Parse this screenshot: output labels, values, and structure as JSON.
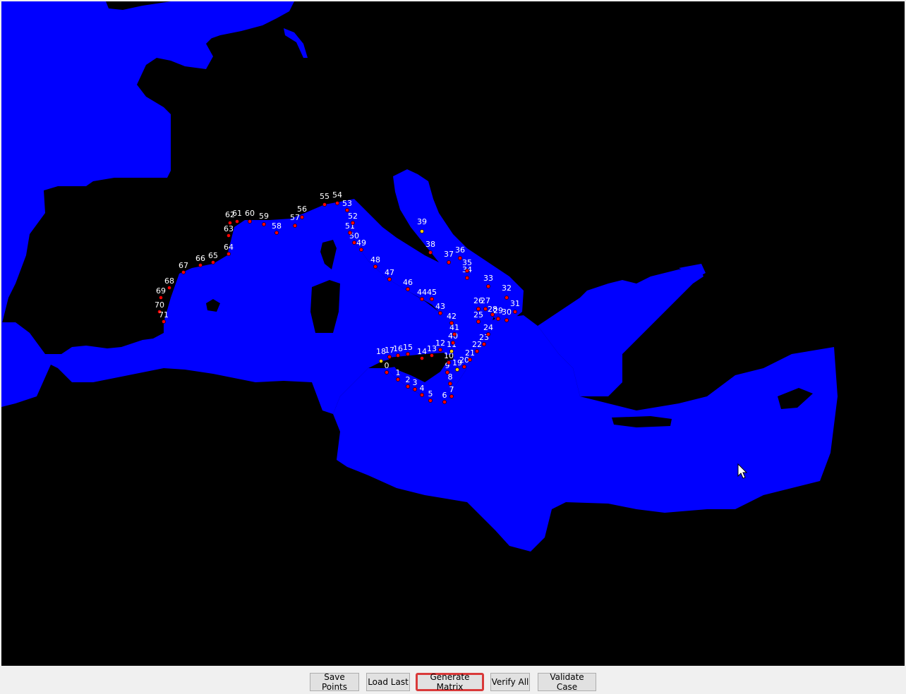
{
  "toolbar": {
    "buttons": [
      {
        "label": "Save Points"
      },
      {
        "label": "Load Last"
      },
      {
        "label": "Generate Matrix",
        "highlighted": true
      },
      {
        "label": "Verify All"
      },
      {
        "label": "Validate Case"
      }
    ]
  },
  "map": {
    "background_color": "#000000",
    "water_color": "#0000ff",
    "point_color": "#ff0000",
    "special_point_color": "#ffcc00",
    "label_color": "#ffffff",
    "special_points": [
      39,
      18,
      19,
      11
    ],
    "point_labels": [
      "0",
      "1",
      "2",
      "3",
      "4",
      "5",
      "6",
      "7",
      "8",
      "9",
      "10",
      "11",
      "12",
      "13",
      "14",
      "15",
      "16",
      "17",
      "18",
      "19",
      "20",
      "21",
      "22",
      "23",
      "24",
      "25",
      "26",
      "27",
      "28",
      "29",
      "30",
      "31",
      "32",
      "33",
      "34",
      "35",
      "36",
      "37",
      "38",
      "39",
      "40",
      "41",
      "42",
      "43",
      "44",
      "45",
      "46",
      "47",
      "48",
      "49",
      "50",
      "51",
      "52",
      "53",
      "54",
      "55",
      "56",
      "57",
      "58",
      "59",
      "60",
      "61",
      "62",
      "63",
      "64",
      "65",
      "66",
      "67",
      "68",
      "69",
      "70",
      "71"
    ]
  },
  "cursor": {
    "icon": "arrow-cursor-icon"
  }
}
